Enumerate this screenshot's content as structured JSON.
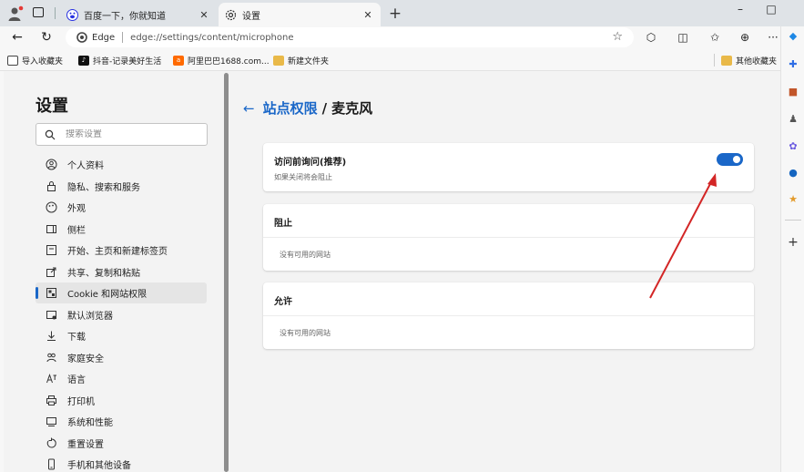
{
  "browser": {
    "tabs": [
      {
        "title": "百度一下，你就知道",
        "icon": "baidu-icon",
        "active": false
      },
      {
        "title": "设置",
        "icon": "gear-icon",
        "active": true
      }
    ],
    "window_controls": {
      "minimize": "–",
      "maximize": "□"
    },
    "address": {
      "brand": "Edge",
      "url": "edge://settings/content/microphone"
    },
    "favorites": [
      {
        "label": "导入收藏夹",
        "icon": "import-icon"
      },
      {
        "label": "抖音-记录美好生活",
        "icon": "douyin-icon"
      },
      {
        "label": "阿里巴巴1688.com...",
        "icon": "alibaba-icon"
      },
      {
        "label": "新建文件夹",
        "icon": "folder-icon"
      }
    ],
    "other_favorites": "其他收藏夹"
  },
  "settings": {
    "title": "设置",
    "search_placeholder": "搜索设置",
    "nav": [
      {
        "label": "个人资料",
        "icon": "profile-icon"
      },
      {
        "label": "隐私、搜索和服务",
        "icon": "lock-icon"
      },
      {
        "label": "外观",
        "icon": "appearance-icon"
      },
      {
        "label": "侧栏",
        "icon": "sidebar-icon"
      },
      {
        "label": "开始、主页和新建标签页",
        "icon": "home-icon"
      },
      {
        "label": "共享、复制和粘贴",
        "icon": "share-icon"
      },
      {
        "label": "Cookie 和网站权限",
        "icon": "cookie-icon",
        "active": true
      },
      {
        "label": "默认浏览器",
        "icon": "default-browser-icon"
      },
      {
        "label": "下载",
        "icon": "download-icon"
      },
      {
        "label": "家庭安全",
        "icon": "family-icon"
      },
      {
        "label": "语言",
        "icon": "language-icon"
      },
      {
        "label": "打印机",
        "icon": "printer-icon"
      },
      {
        "label": "系统和性能",
        "icon": "system-icon"
      },
      {
        "label": "重置设置",
        "icon": "reset-icon"
      },
      {
        "label": "手机和其他设备",
        "icon": "phone-icon"
      }
    ]
  },
  "page": {
    "breadcrumb_link": "站点权限",
    "breadcrumb_sep": "/",
    "breadcrumb_current": "麦克风",
    "ask_title": "访问前询问(推荐)",
    "ask_subtitle": "如果关闭将会阻止",
    "ask_enabled": true,
    "block_title": "阻止",
    "block_empty": "没有可用的网站",
    "allow_title": "允许",
    "allow_empty": "没有可用的网站"
  },
  "colors": {
    "accent": "#1a67c8",
    "annotation_arrow": "#d32626"
  }
}
